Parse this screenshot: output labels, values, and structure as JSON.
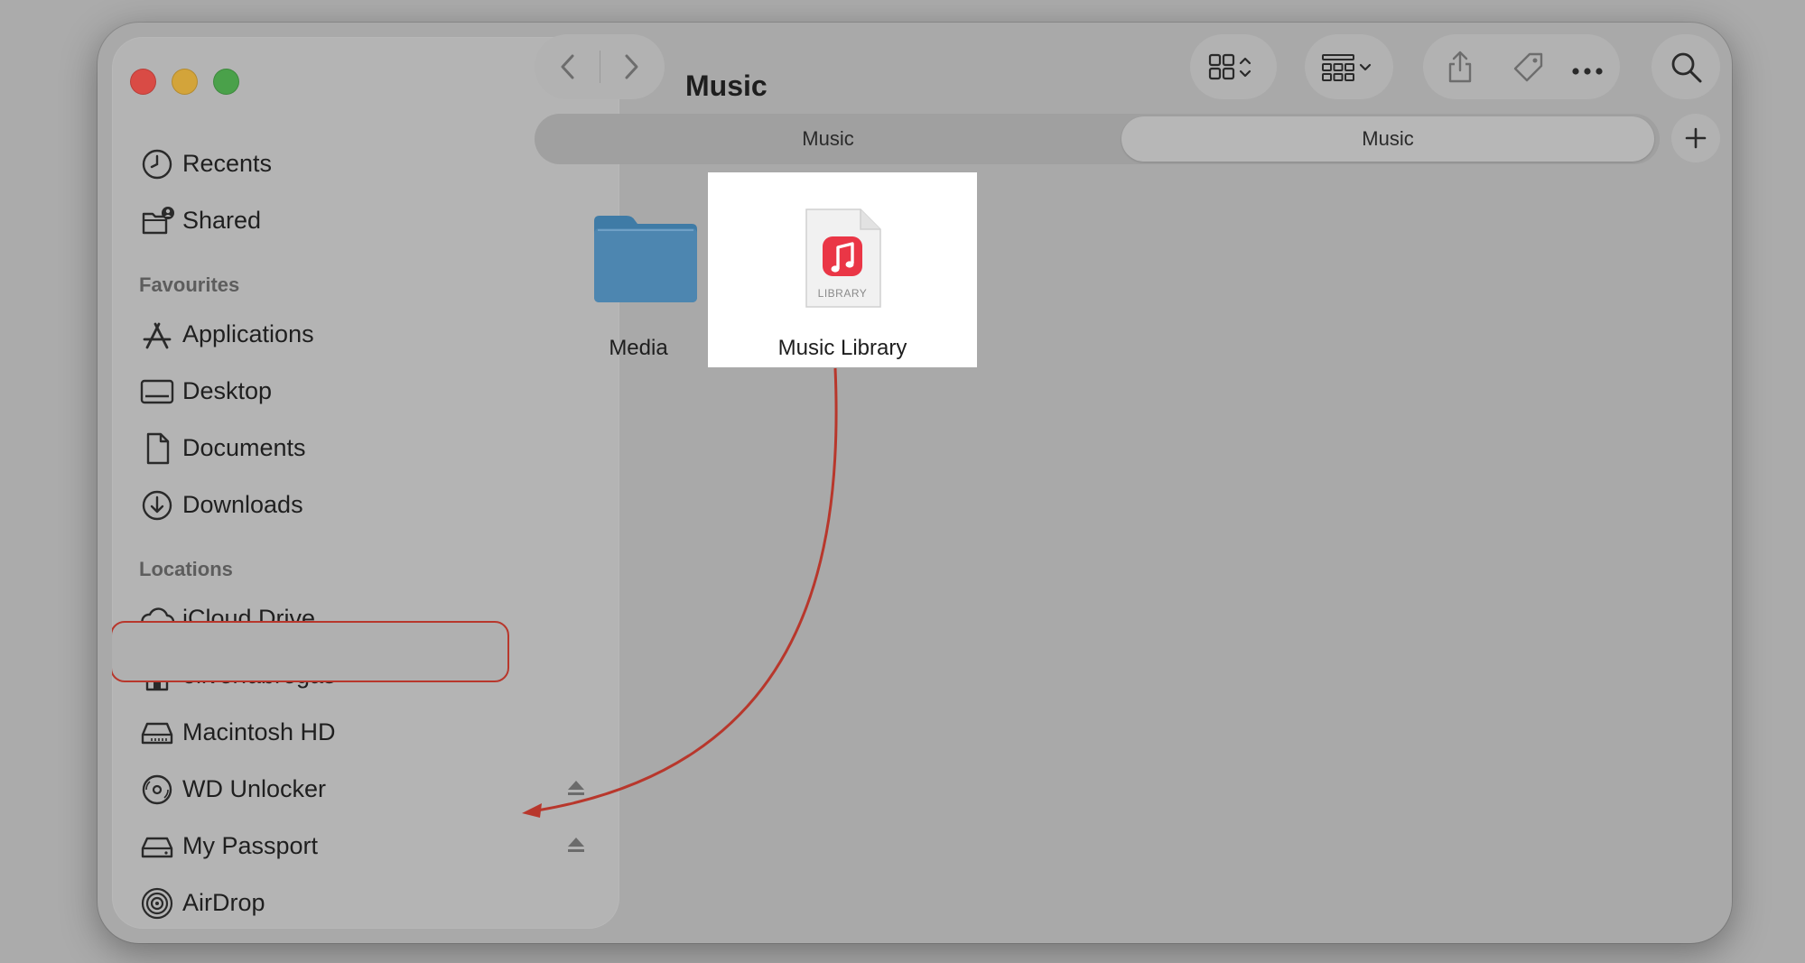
{
  "window": {
    "title": "Music"
  },
  "sidebar": {
    "top_items": [
      {
        "label": "Recents",
        "icon": "clock-icon"
      },
      {
        "label": "Shared",
        "icon": "shared-folder-icon"
      }
    ],
    "favourites": {
      "heading": "Favourites",
      "items": [
        {
          "label": "Applications",
          "icon": "applications-icon"
        },
        {
          "label": "Desktop",
          "icon": "desktop-icon"
        },
        {
          "label": "Documents",
          "icon": "document-icon"
        },
        {
          "label": "Downloads",
          "icon": "download-icon"
        }
      ]
    },
    "locations": {
      "heading": "Locations",
      "items": [
        {
          "label": "iCloud Drive",
          "icon": "cloud-icon"
        },
        {
          "label": "oliverfabregas",
          "icon": "home-icon"
        },
        {
          "label": "Macintosh HD",
          "icon": "hard-drive-icon"
        },
        {
          "label": "WD Unlocker",
          "icon": "disc-icon",
          "ejectable": true
        },
        {
          "label": "My Passport",
          "icon": "external-drive-icon",
          "ejectable": true,
          "highlighted": true
        },
        {
          "label": "AirDrop",
          "icon": "airdrop-icon"
        }
      ]
    }
  },
  "tabs": [
    {
      "label": "Music",
      "active": false
    },
    {
      "label": "Music",
      "active": true
    }
  ],
  "files": [
    {
      "name": "Media",
      "kind": "folder",
      "selected": false
    },
    {
      "name": "Music Library",
      "kind": "music-library",
      "badge": "LIBRARY",
      "selected": true
    }
  ],
  "annotation": {
    "color": "#b8372c",
    "from": "Music Library",
    "to": "My Passport"
  }
}
